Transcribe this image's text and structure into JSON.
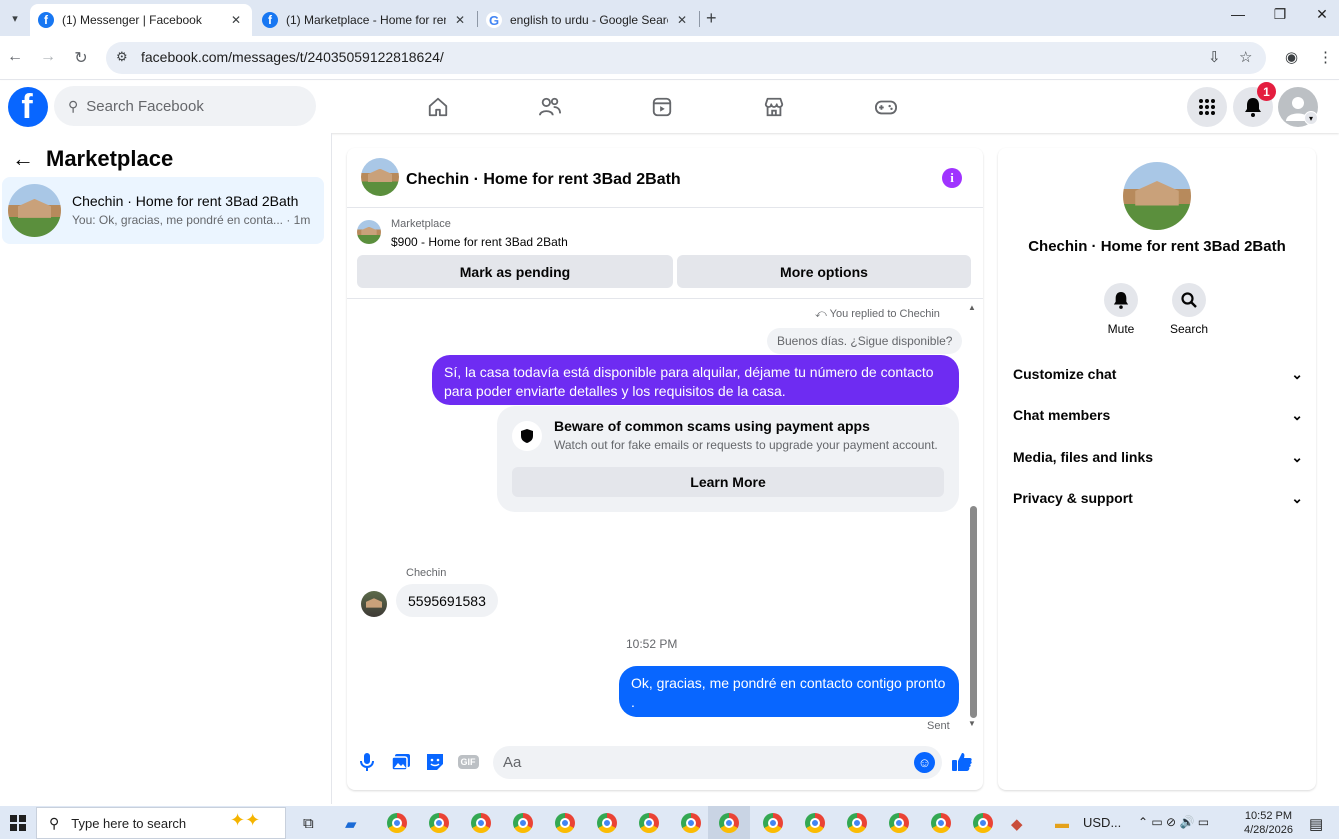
{
  "browser": {
    "tabs": [
      {
        "title": "(1) Messenger | Facebook",
        "active": true
      },
      {
        "title": "(1) Marketplace - Home for ren",
        "active": false
      },
      {
        "title": "english to urdu - Google Searc",
        "active": false
      }
    ],
    "url": "facebook.com/messages/t/24035059122818624/"
  },
  "fb": {
    "search_placeholder": "Search Facebook",
    "notification_count": "1"
  },
  "sidebar": {
    "title": "Marketplace",
    "conversations": [
      {
        "name": "Chechin · Home for rent 3Bad 2Bath",
        "preview": "You: Ok, gracias, me pondré en conta... · 1m"
      }
    ]
  },
  "chat": {
    "title": "Chechin · Home for rent 3Bad 2Bath",
    "marketplace_label": "Marketplace",
    "listing": "$900 - Home for rent 3Bad 2Bath",
    "mark_pending": "Mark as pending",
    "more_options": "More options",
    "replied_note": "You replied to Chechin",
    "quoted_message": "Buenos días. ¿Sigue disponible?",
    "messages": [
      {
        "from": "me",
        "text": "Sí, la casa todavía está disponible para alquilar, déjame tu número de contacto para poder enviarte detalles y los requisitos de la casa."
      },
      {
        "from": "Chechin",
        "text": "5595691583"
      },
      {
        "from": "me",
        "text": "Ok, gracias, me pondré en contacto contigo pronto ."
      }
    ],
    "scam_notice": {
      "title": "Beware of common scams using payment apps",
      "desc": "Watch out for fake emails or requests to upgrade your payment account.",
      "button": "Learn More"
    },
    "sender_name": "Chechin",
    "timestamp": "10:52 PM",
    "status": "Sent",
    "input_placeholder": "Aa",
    "gif_label": "GIF"
  },
  "details": {
    "name": "Chechin · Home for rent 3Bad 2Bath",
    "mute": "Mute",
    "search": "Search",
    "sections": [
      "Customize chat",
      "Chat members",
      "Media, files and links",
      "Privacy & support"
    ]
  },
  "taskbar": {
    "search_placeholder": "Type here to search",
    "weather": "USD...",
    "time": "10:52 PM",
    "date": "4/28/2026"
  },
  "colors": {
    "fb_blue": "#0866ff",
    "purple_bubble": "#6e2cf2",
    "badge_red": "#e41e3f"
  }
}
